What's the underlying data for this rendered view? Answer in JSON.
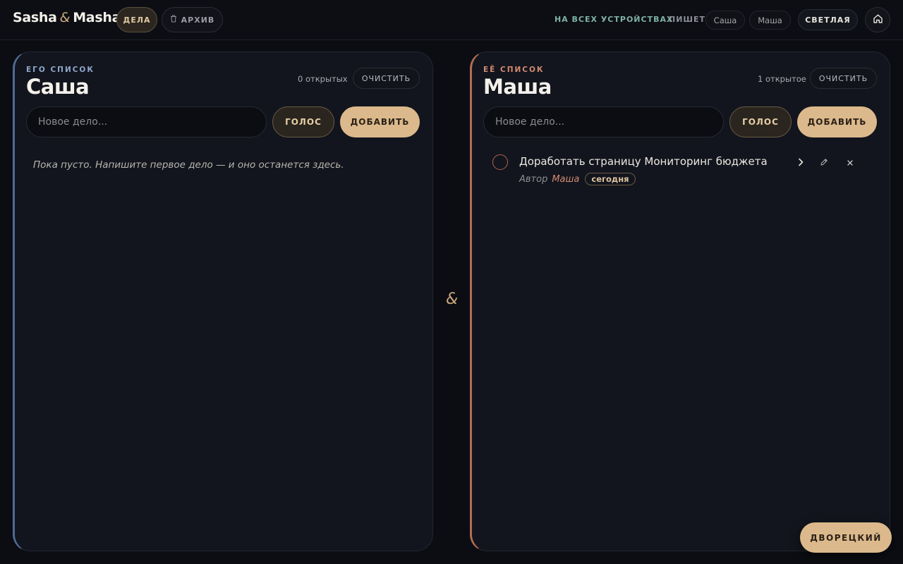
{
  "header": {
    "brand_left": "Sasha",
    "brand_amp": "&",
    "brand_right": "Masha",
    "tabs": [
      {
        "label": "ДЕЛА",
        "active": true
      },
      {
        "label": "АРХИВ",
        "icon": "trash-icon",
        "active": false
      }
    ],
    "sync_label": "НА ВСЕХ УСТРОЙСТВАХ",
    "writer_label": "ПИШЕТ",
    "writers": [
      "Саша",
      "Маша"
    ],
    "theme_label": "СВЕТЛАЯ",
    "home_icon": "home-icon"
  },
  "his": {
    "eyebrow": "ЕГО СПИСОК",
    "name": "Саша",
    "open_count": "0 открытых",
    "clear_label": "ОЧИСТИТЬ",
    "input_placeholder": "Новое дело...",
    "voice_label": "ГОЛОС",
    "add_label": "ДОБАВИТЬ",
    "empty_text": "Пока пусто. Напишите первое дело — и оно останется здесь.",
    "accent": "#4e6a93"
  },
  "hers": {
    "eyebrow": "ЕЁ СПИСОК",
    "name": "Маша",
    "open_count": "1 открытое",
    "clear_label": "ОЧИСТИТЬ",
    "input_placeholder": "Новое дело...",
    "voice_label": "ГОЛОС",
    "add_label": "ДОБАВИТЬ",
    "accent": "#b36d57",
    "tasks": [
      {
        "title": "Доработать страницу Мониторинг бюджета",
        "author_label": "Автор",
        "author": "Маша",
        "when": "сегодня",
        "actions": [
          "chevron-right-icon",
          "pencil-icon",
          "close-icon"
        ]
      }
    ]
  },
  "divider_symbol": "&",
  "butler_label": "ДВОРЕЦКИЙ",
  "colors": {
    "background": "#0b0d12",
    "panel": "#12151d",
    "gold": "#dcb98c",
    "his_accent": "#4e6a93",
    "hers_accent": "#b36d57",
    "sync": "#7fb3a3"
  }
}
